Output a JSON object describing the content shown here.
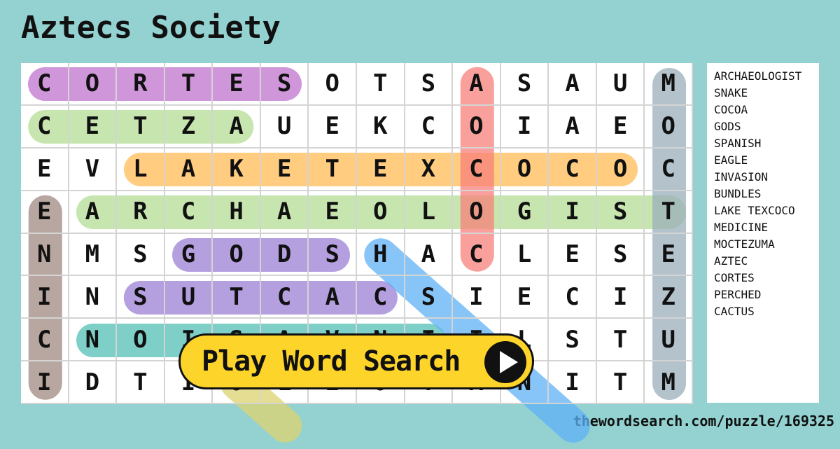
{
  "title": "Aztecs Society",
  "grid": {
    "rows": [
      [
        "C",
        "O",
        "R",
        "T",
        "E",
        "S",
        "O",
        "T",
        "S",
        "A",
        "S",
        "A",
        "U",
        "M"
      ],
      [
        "C",
        "E",
        "T",
        "Z",
        "A",
        "U",
        "E",
        "K",
        "C",
        "O",
        "I",
        "A",
        "E",
        "O"
      ],
      [
        "E",
        "V",
        "L",
        "A",
        "K",
        "E",
        "T",
        "E",
        "X",
        "C",
        "O",
        "C",
        "O",
        "C"
      ],
      [
        "E",
        "A",
        "R",
        "C",
        "H",
        "A",
        "E",
        "O",
        "L",
        "O",
        "G",
        "I",
        "S",
        "T"
      ],
      [
        "N",
        "M",
        "S",
        "G",
        "O",
        "D",
        "S",
        "H",
        "A",
        "C",
        "L",
        "E",
        "S",
        "E"
      ],
      [
        "I",
        "N",
        "S",
        "U",
        "T",
        "C",
        "A",
        "C",
        "S",
        "I",
        "E",
        "C",
        "I",
        "Z"
      ],
      [
        "C",
        "N",
        "O",
        "I",
        "S",
        "A",
        "V",
        "N",
        "I",
        "I",
        "L",
        "S",
        "T",
        "U"
      ],
      [
        "I",
        "D",
        "T",
        "I",
        "O",
        "L",
        "E",
        "O",
        "T",
        "A",
        "N",
        "I",
        "T",
        "M"
      ]
    ]
  },
  "highlights": [
    {
      "word": "CORTES",
      "color": "#bf74cc",
      "start": [
        0,
        0
      ],
      "end": [
        0,
        5
      ]
    },
    {
      "word": "AZTEC",
      "color": "#b3dc94",
      "start": [
        1,
        4
      ],
      "end": [
        1,
        0
      ]
    },
    {
      "word": "LAKE TEXCOCO",
      "color": "#ffbb55",
      "start": [
        2,
        2
      ],
      "end": [
        2,
        12
      ]
    },
    {
      "word": "ARCHAEOLOGIST",
      "color": "#b3dc94",
      "start": [
        3,
        1
      ],
      "end": [
        3,
        13
      ]
    },
    {
      "word": "GODS",
      "color": "#9b7fd4",
      "start": [
        4,
        3
      ],
      "end": [
        4,
        6
      ]
    },
    {
      "word": "CACTUS",
      "color": "#9b7fd4",
      "start": [
        5,
        7
      ],
      "end": [
        5,
        2
      ]
    },
    {
      "word": "INVASION",
      "color": "#52bfb4",
      "start": [
        6,
        8
      ],
      "end": [
        6,
        1
      ]
    },
    {
      "word": "COCOA",
      "color": "#f7807b",
      "start": [
        4,
        9
      ],
      "end": [
        0,
        9
      ]
    },
    {
      "word": "MOCTEZUMA",
      "color": "#9aaeba",
      "start": [
        0,
        13
      ],
      "end": [
        7,
        13
      ]
    },
    {
      "word": "MEDICINE",
      "color": "#a08a80",
      "start": [
        7,
        0
      ],
      "end": [
        3,
        0
      ]
    },
    {
      "word": "SPANISH",
      "color": "#5fb0f5",
      "start": [
        4,
        7
      ],
      "end": [
        8,
        11
      ]
    },
    {
      "word": "EAGLE",
      "color": "#dcd36e",
      "start": [
        7,
        4
      ],
      "end": [
        8,
        5
      ]
    }
  ],
  "wordlist": [
    "ARCHAEOLOGIST",
    "SNAKE",
    "COCOA",
    "GODS",
    "SPANISH",
    "EAGLE",
    "INVASION",
    "BUNDLES",
    "LAKE TEXCOCO",
    "MEDICINE",
    "MOCTEZUMA",
    "AZTEC",
    "CORTES",
    "PERCHED",
    "CACTUS"
  ],
  "play_button": {
    "label": "Play Word Search",
    "icon": "play-icon"
  },
  "footer_url": "thewordsearch.com/puzzle/169325"
}
